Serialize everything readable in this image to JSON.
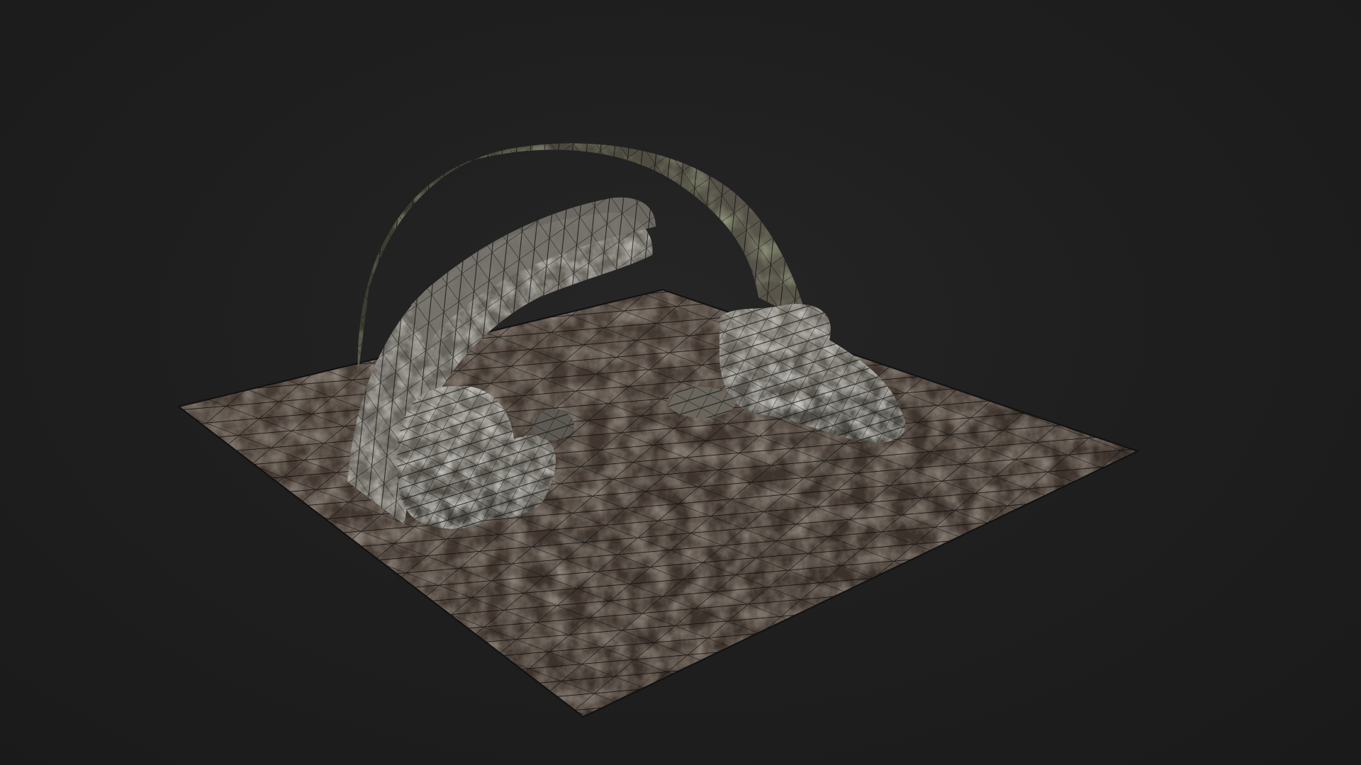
{
  "viewport": {
    "background_color": "#1e1e1e",
    "render_mode": "textured-wireframe",
    "wire_color": "#0a0a0a"
  },
  "scene": {
    "subject": "stone-arch",
    "ground_colors": [
      "#3a302a",
      "#4a4038",
      "#5a5048"
    ],
    "rock_colors": [
      "#3c3a33",
      "#55524a",
      "#8a877f"
    ],
    "moss_color": "#4a5236"
  }
}
